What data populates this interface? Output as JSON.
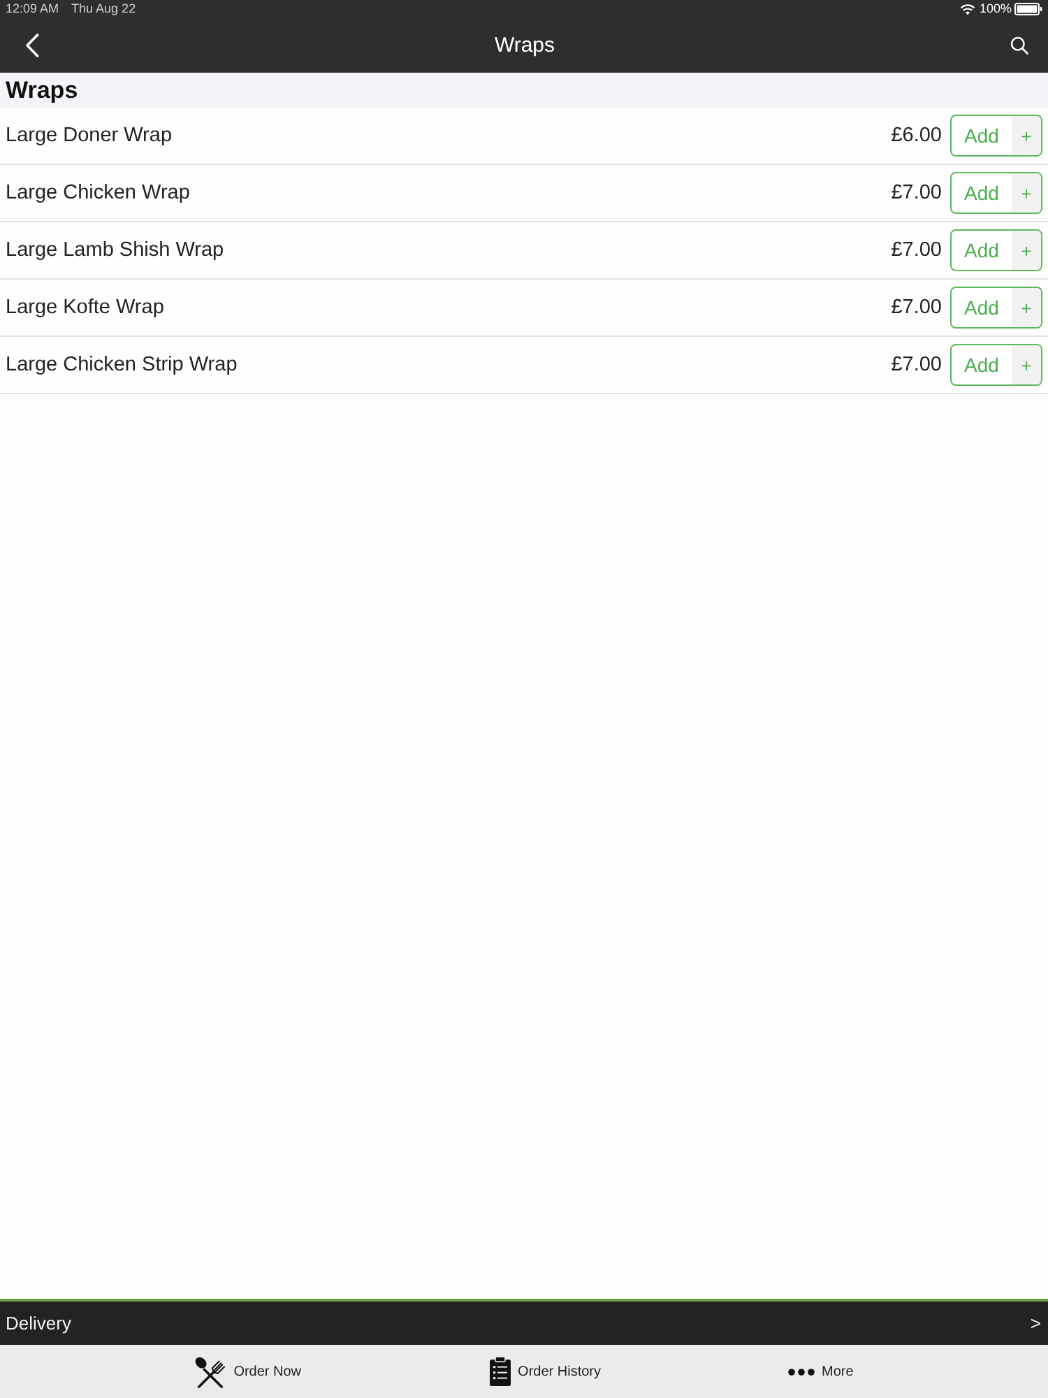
{
  "status_bar": {
    "time": "12:09 AM",
    "date": "Thu Aug 22",
    "battery": "100%"
  },
  "nav_bar": {
    "title": "Wraps"
  },
  "section": {
    "title": "Wraps"
  },
  "items": [
    {
      "name": "Large Doner Wrap",
      "price": "£6.00",
      "add_label": "Add",
      "plus": "+"
    },
    {
      "name": "Large Chicken Wrap",
      "price": "£7.00",
      "add_label": "Add",
      "plus": "+"
    },
    {
      "name": "Large Lamb Shish Wrap",
      "price": "£7.00",
      "add_label": "Add",
      "plus": "+"
    },
    {
      "name": "Large Kofte Wrap",
      "price": "£7.00",
      "add_label": "Add",
      "plus": "+"
    },
    {
      "name": "Large Chicken Strip Wrap",
      "price": "£7.00",
      "add_label": "Add",
      "plus": "+"
    }
  ],
  "delivery_bar": {
    "label": "Delivery",
    "chevron": ">"
  },
  "tab_bar": [
    {
      "label": "Order Now",
      "kind": "utensils"
    },
    {
      "label": "Order History",
      "kind": "clipboard"
    },
    {
      "label": "More",
      "kind": "dots"
    }
  ]
}
